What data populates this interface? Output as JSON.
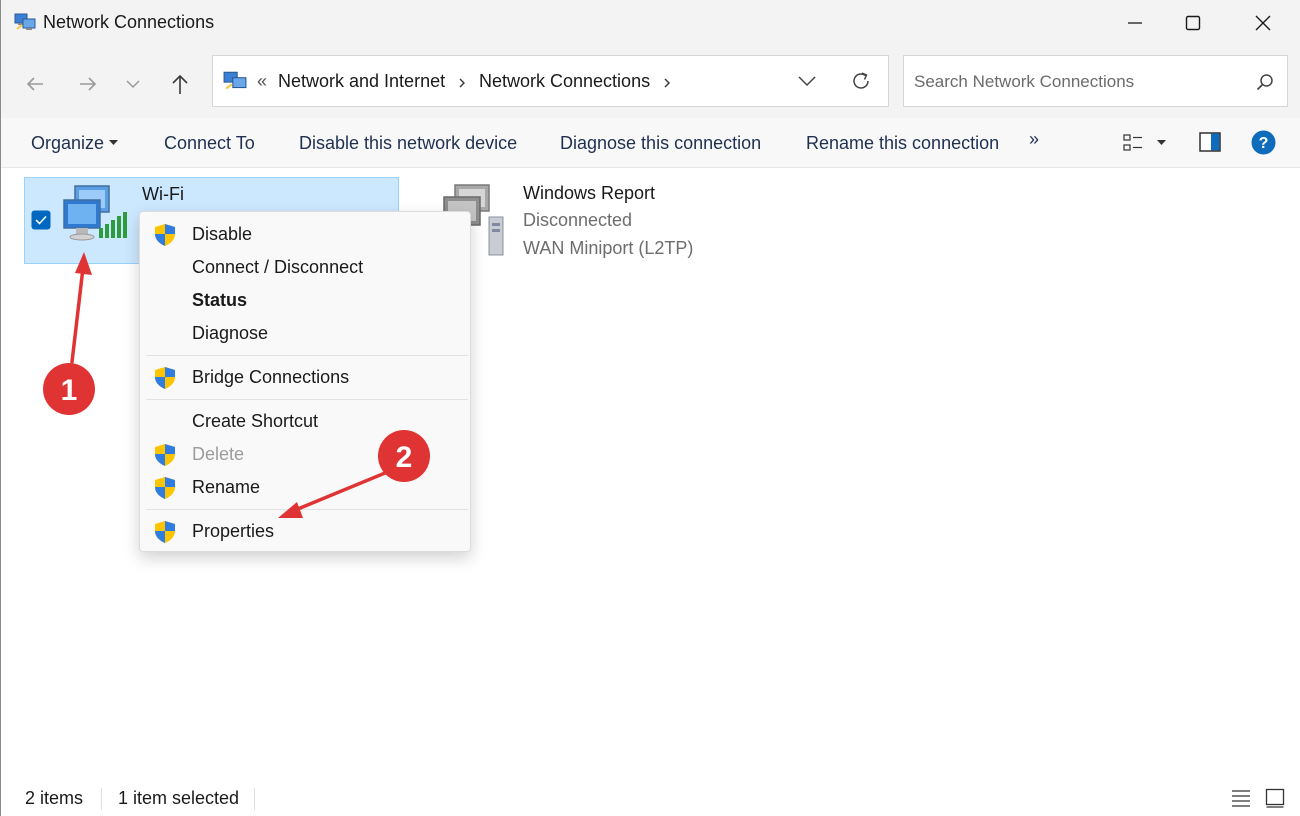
{
  "window": {
    "title": "Network Connections"
  },
  "nav": {
    "breadcrumb_overflow": "«",
    "breadcrumb": [
      "Network and Internet",
      "Network Connections"
    ],
    "search_placeholder": "Search Network Connections"
  },
  "toolbar": {
    "organize": "Organize",
    "connect_to": "Connect To",
    "disable": "Disable this network device",
    "diagnose": "Diagnose this connection",
    "rename": "Rename this connection",
    "more": "»"
  },
  "items": [
    {
      "name": "Wi-Fi",
      "selected": true
    },
    {
      "name": "Windows Report",
      "status": "Disconnected",
      "device": "WAN Miniport (L2TP)"
    }
  ],
  "context_menu": {
    "disable": "Disable",
    "connect_disconnect": "Connect / Disconnect",
    "status": "Status",
    "diagnose": "Diagnose",
    "bridge": "Bridge Connections",
    "create_shortcut": "Create Shortcut",
    "delete": "Delete",
    "rename": "Rename",
    "properties": "Properties"
  },
  "annotations": {
    "step1": "1",
    "step2": "2",
    "color": "#e03434"
  },
  "statusbar": {
    "count": "2 items",
    "selected": "1 item selected"
  },
  "colors": {
    "selection_bg": "#cce8ff",
    "selection_border": "#99d1ff",
    "help_blue": "#0f6cbd",
    "accent": "#0067c0"
  }
}
